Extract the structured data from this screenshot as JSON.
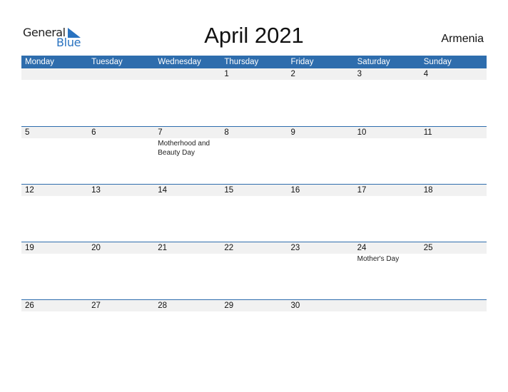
{
  "logo": {
    "line1": "General",
    "line2": "Blue",
    "icon": "triangle-flag-icon"
  },
  "title": "April 2021",
  "country": "Armenia",
  "colors": {
    "header_bg": "#2e6dad",
    "brand_blue": "#2a73c0",
    "date_band": "#f1f1f1"
  },
  "weekdays": [
    "Monday",
    "Tuesday",
    "Wednesday",
    "Thursday",
    "Friday",
    "Saturday",
    "Sunday"
  ],
  "weeks": [
    [
      {
        "d": ""
      },
      {
        "d": ""
      },
      {
        "d": ""
      },
      {
        "d": "1"
      },
      {
        "d": "2"
      },
      {
        "d": "3"
      },
      {
        "d": "4"
      }
    ],
    [
      {
        "d": "5"
      },
      {
        "d": "6"
      },
      {
        "d": "7",
        "h": "Motherhood and Beauty Day"
      },
      {
        "d": "8"
      },
      {
        "d": "9"
      },
      {
        "d": "10"
      },
      {
        "d": "11"
      }
    ],
    [
      {
        "d": "12"
      },
      {
        "d": "13"
      },
      {
        "d": "14"
      },
      {
        "d": "15"
      },
      {
        "d": "16"
      },
      {
        "d": "17"
      },
      {
        "d": "18"
      }
    ],
    [
      {
        "d": "19"
      },
      {
        "d": "20"
      },
      {
        "d": "21"
      },
      {
        "d": "22"
      },
      {
        "d": "23"
      },
      {
        "d": "24",
        "h": "Mother's Day"
      },
      {
        "d": "25"
      }
    ],
    [
      {
        "d": "26"
      },
      {
        "d": "27"
      },
      {
        "d": "28"
      },
      {
        "d": "29"
      },
      {
        "d": "30"
      },
      {
        "d": ""
      },
      {
        "d": ""
      }
    ]
  ]
}
